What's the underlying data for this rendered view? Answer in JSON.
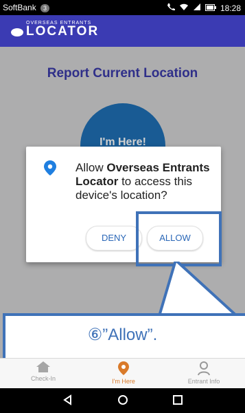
{
  "status_bar": {
    "carrier": "SoftBank",
    "carrier_badge": "3",
    "time": "18:28"
  },
  "header": {
    "brand_small": "OVERSEAS ENTRANTS",
    "brand_big": "LOCATOR"
  },
  "main": {
    "title": "Report Current Location",
    "here_button_label": "I'm Here!"
  },
  "dialog": {
    "message_part1": "Allow ",
    "message_bold": "Overseas Entrants Locator",
    "message_part2": " to access this device's location?",
    "deny_label": "DENY",
    "allow_label": "ALLOW"
  },
  "annotation": {
    "callout_text": "⑥”Allow”."
  },
  "bottom_nav": {
    "items": [
      {
        "label": "Check-In",
        "icon": "house-icon"
      },
      {
        "label": "I'm Here",
        "icon": "location-pin-icon"
      },
      {
        "label": "Entrant Info",
        "icon": "person-icon"
      }
    ]
  },
  "colors": {
    "app_bar": "#3b3bb3",
    "accent": "#3f72b8",
    "circle_button": "#1f6fb5",
    "active_nav": "#d97a2a"
  }
}
